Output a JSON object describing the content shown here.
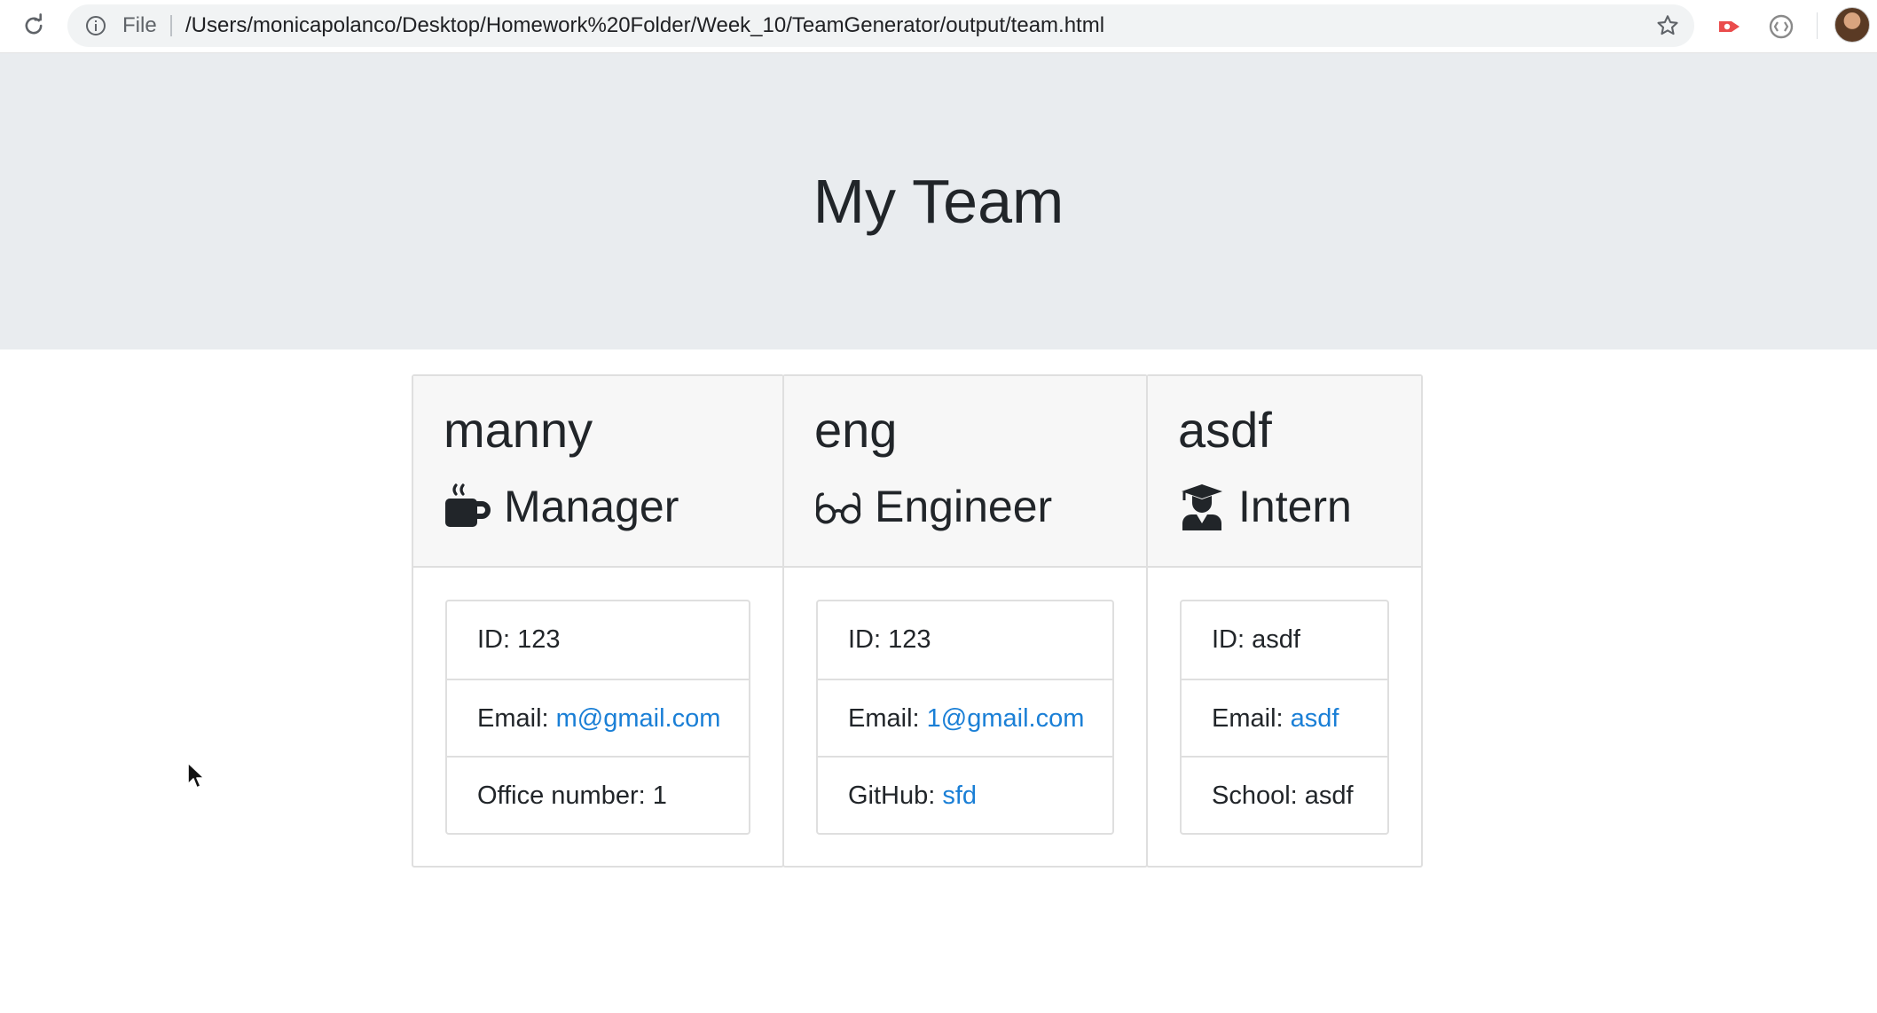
{
  "browser": {
    "scheme_label": "File",
    "url": "/Users/monicapolanco/Desktop/Homework%20Folder/Week_10/TeamGenerator/output/team.html"
  },
  "page": {
    "title": "My Team"
  },
  "team": [
    {
      "name": "manny",
      "role": "Manager",
      "icon": "coffee-mug-icon",
      "id_line": "ID: 123",
      "email_label": "Email: ",
      "email": "m@gmail.com",
      "extra_label": "Office number: ",
      "extra_value": "1"
    },
    {
      "name": "eng",
      "role": "Engineer",
      "icon": "glasses-icon",
      "id_line": "ID: 123",
      "email_label": "Email: ",
      "email": "1@gmail.com",
      "extra_label": "GitHub: ",
      "extra_value": "sfd"
    },
    {
      "name": "asdf",
      "role": "Intern",
      "icon": "graduate-icon",
      "id_line": "ID: asdf",
      "email_label": "Email: ",
      "email": "asdf",
      "extra_label": "School: ",
      "extra_value": "asdf"
    }
  ],
  "colors": {
    "jumbotron_bg": "#e9ecef",
    "link": "#1a7fd6",
    "card_header_bg": "#f7f7f7"
  }
}
